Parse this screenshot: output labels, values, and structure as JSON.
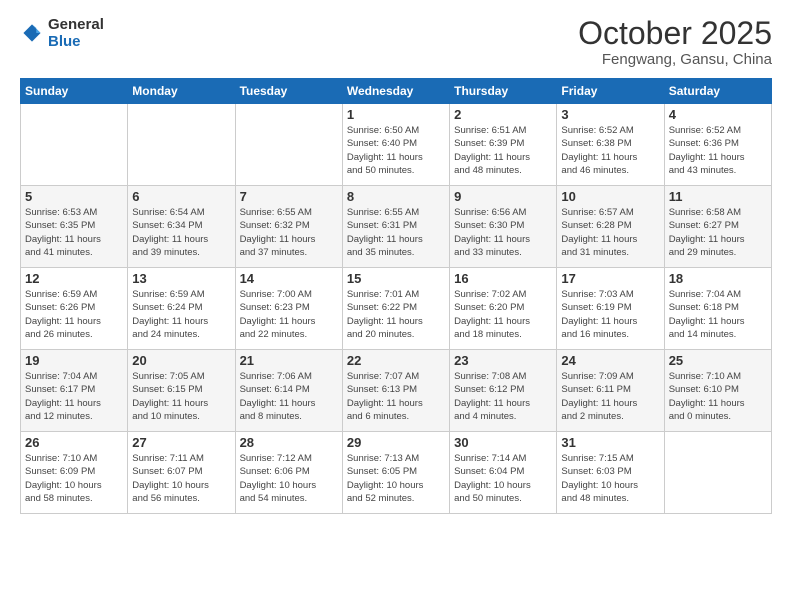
{
  "logo": {
    "line1": "General",
    "line2": "Blue"
  },
  "title": "October 2025",
  "location": "Fengwang, Gansu, China",
  "weekdays": [
    "Sunday",
    "Monday",
    "Tuesday",
    "Wednesday",
    "Thursday",
    "Friday",
    "Saturday"
  ],
  "weeks": [
    [
      {
        "day": "",
        "info": ""
      },
      {
        "day": "",
        "info": ""
      },
      {
        "day": "",
        "info": ""
      },
      {
        "day": "1",
        "info": "Sunrise: 6:50 AM\nSunset: 6:40 PM\nDaylight: 11 hours\nand 50 minutes."
      },
      {
        "day": "2",
        "info": "Sunrise: 6:51 AM\nSunset: 6:39 PM\nDaylight: 11 hours\nand 48 minutes."
      },
      {
        "day": "3",
        "info": "Sunrise: 6:52 AM\nSunset: 6:38 PM\nDaylight: 11 hours\nand 46 minutes."
      },
      {
        "day": "4",
        "info": "Sunrise: 6:52 AM\nSunset: 6:36 PM\nDaylight: 11 hours\nand 43 minutes."
      }
    ],
    [
      {
        "day": "5",
        "info": "Sunrise: 6:53 AM\nSunset: 6:35 PM\nDaylight: 11 hours\nand 41 minutes."
      },
      {
        "day": "6",
        "info": "Sunrise: 6:54 AM\nSunset: 6:34 PM\nDaylight: 11 hours\nand 39 minutes."
      },
      {
        "day": "7",
        "info": "Sunrise: 6:55 AM\nSunset: 6:32 PM\nDaylight: 11 hours\nand 37 minutes."
      },
      {
        "day": "8",
        "info": "Sunrise: 6:55 AM\nSunset: 6:31 PM\nDaylight: 11 hours\nand 35 minutes."
      },
      {
        "day": "9",
        "info": "Sunrise: 6:56 AM\nSunset: 6:30 PM\nDaylight: 11 hours\nand 33 minutes."
      },
      {
        "day": "10",
        "info": "Sunrise: 6:57 AM\nSunset: 6:28 PM\nDaylight: 11 hours\nand 31 minutes."
      },
      {
        "day": "11",
        "info": "Sunrise: 6:58 AM\nSunset: 6:27 PM\nDaylight: 11 hours\nand 29 minutes."
      }
    ],
    [
      {
        "day": "12",
        "info": "Sunrise: 6:59 AM\nSunset: 6:26 PM\nDaylight: 11 hours\nand 26 minutes."
      },
      {
        "day": "13",
        "info": "Sunrise: 6:59 AM\nSunset: 6:24 PM\nDaylight: 11 hours\nand 24 minutes."
      },
      {
        "day": "14",
        "info": "Sunrise: 7:00 AM\nSunset: 6:23 PM\nDaylight: 11 hours\nand 22 minutes."
      },
      {
        "day": "15",
        "info": "Sunrise: 7:01 AM\nSunset: 6:22 PM\nDaylight: 11 hours\nand 20 minutes."
      },
      {
        "day": "16",
        "info": "Sunrise: 7:02 AM\nSunset: 6:20 PM\nDaylight: 11 hours\nand 18 minutes."
      },
      {
        "day": "17",
        "info": "Sunrise: 7:03 AM\nSunset: 6:19 PM\nDaylight: 11 hours\nand 16 minutes."
      },
      {
        "day": "18",
        "info": "Sunrise: 7:04 AM\nSunset: 6:18 PM\nDaylight: 11 hours\nand 14 minutes."
      }
    ],
    [
      {
        "day": "19",
        "info": "Sunrise: 7:04 AM\nSunset: 6:17 PM\nDaylight: 11 hours\nand 12 minutes."
      },
      {
        "day": "20",
        "info": "Sunrise: 7:05 AM\nSunset: 6:15 PM\nDaylight: 11 hours\nand 10 minutes."
      },
      {
        "day": "21",
        "info": "Sunrise: 7:06 AM\nSunset: 6:14 PM\nDaylight: 11 hours\nand 8 minutes."
      },
      {
        "day": "22",
        "info": "Sunrise: 7:07 AM\nSunset: 6:13 PM\nDaylight: 11 hours\nand 6 minutes."
      },
      {
        "day": "23",
        "info": "Sunrise: 7:08 AM\nSunset: 6:12 PM\nDaylight: 11 hours\nand 4 minutes."
      },
      {
        "day": "24",
        "info": "Sunrise: 7:09 AM\nSunset: 6:11 PM\nDaylight: 11 hours\nand 2 minutes."
      },
      {
        "day": "25",
        "info": "Sunrise: 7:10 AM\nSunset: 6:10 PM\nDaylight: 11 hours\nand 0 minutes."
      }
    ],
    [
      {
        "day": "26",
        "info": "Sunrise: 7:10 AM\nSunset: 6:09 PM\nDaylight: 10 hours\nand 58 minutes."
      },
      {
        "day": "27",
        "info": "Sunrise: 7:11 AM\nSunset: 6:07 PM\nDaylight: 10 hours\nand 56 minutes."
      },
      {
        "day": "28",
        "info": "Sunrise: 7:12 AM\nSunset: 6:06 PM\nDaylight: 10 hours\nand 54 minutes."
      },
      {
        "day": "29",
        "info": "Sunrise: 7:13 AM\nSunset: 6:05 PM\nDaylight: 10 hours\nand 52 minutes."
      },
      {
        "day": "30",
        "info": "Sunrise: 7:14 AM\nSunset: 6:04 PM\nDaylight: 10 hours\nand 50 minutes."
      },
      {
        "day": "31",
        "info": "Sunrise: 7:15 AM\nSunset: 6:03 PM\nDaylight: 10 hours\nand 48 minutes."
      },
      {
        "day": "",
        "info": ""
      }
    ]
  ]
}
